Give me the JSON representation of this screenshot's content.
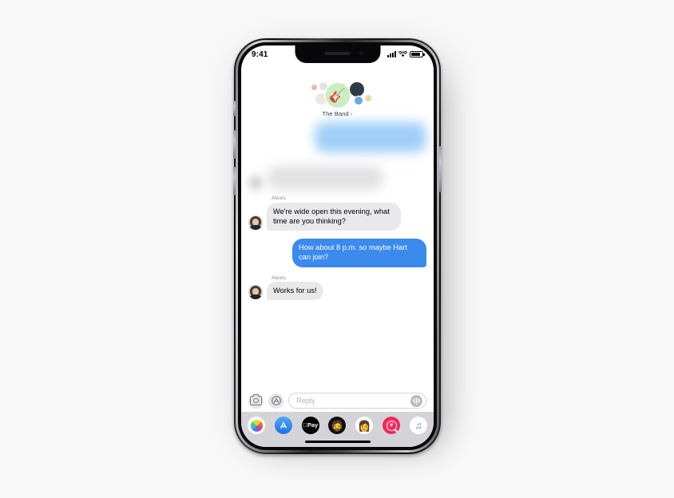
{
  "app": {
    "name": "Messages",
    "platform": "iPhone X"
  },
  "status_bar": {
    "time": "9:41",
    "signal_icon": "cellular-signal-icon",
    "wifi_icon": "wifi-icon",
    "battery_icon": "battery-icon"
  },
  "group_header": {
    "name": "The Band",
    "chevron": "›",
    "main_avatar_emoji": "🎸",
    "main_avatar_bg": "#c9eec2",
    "members": [
      {
        "name": "member-avatar-1",
        "emoji": "👤"
      },
      {
        "name": "member-avatar-2",
        "emoji": "👤"
      },
      {
        "name": "member-avatar-3",
        "emoji": "👩"
      },
      {
        "name": "member-avatar-4",
        "emoji": "👨"
      },
      {
        "name": "member-avatar-5",
        "emoji": "👤"
      },
      {
        "name": "member-avatar-6",
        "emoji": "👤"
      }
    ]
  },
  "conversation": {
    "obscured_note": "earlier messages blurred",
    "messages": [
      {
        "id": "msg-1",
        "direction": "incoming",
        "sender": "Alexis",
        "text": "We're wide open this evening, what time are you thinking?",
        "show_sender": true,
        "show_avatar": true
      },
      {
        "id": "msg-2",
        "direction": "outgoing",
        "sender": "",
        "text": "How about 8 p.m. so maybe Hart can join?",
        "show_sender": false,
        "show_avatar": false
      },
      {
        "id": "msg-3",
        "direction": "incoming",
        "sender": "Alexis",
        "text": "Works for us!",
        "show_sender": true,
        "show_avatar": true
      }
    ]
  },
  "input_bar": {
    "camera_icon": "camera-icon",
    "appstore_icon": "app-store-icon",
    "placeholder": "Reply",
    "value": "",
    "audio_icon": "audio-waveform-icon"
  },
  "app_drawer": {
    "apps": [
      {
        "id": "photos",
        "label": "Photos",
        "icon": "photos-icon"
      },
      {
        "id": "appstore",
        "label": "App Store",
        "icon": "app-store-icon",
        "glyph": "A"
      },
      {
        "id": "applepay",
        "label": "Apple Pay",
        "icon": "apple-pay-icon",
        "glyph": "Pay",
        "mark": ""
      },
      {
        "id": "memoji1",
        "label": "Memoji",
        "icon": "memoji-icon",
        "glyph": "🧔"
      },
      {
        "id": "memoji2",
        "label": "Stickers",
        "icon": "sticker-icon",
        "glyph": "👩"
      },
      {
        "id": "images",
        "label": "#images",
        "icon": "images-search-icon"
      },
      {
        "id": "music",
        "label": "Music",
        "icon": "music-icon",
        "glyph": "♫"
      }
    ]
  },
  "colors": {
    "imessage_blue": "#3b8aed",
    "bubble_gray": "#e9e9eb",
    "drawer_gray": "#d4d4d8",
    "sender_label": "#8a8a8e",
    "page_background": "#f8f8f8"
  }
}
